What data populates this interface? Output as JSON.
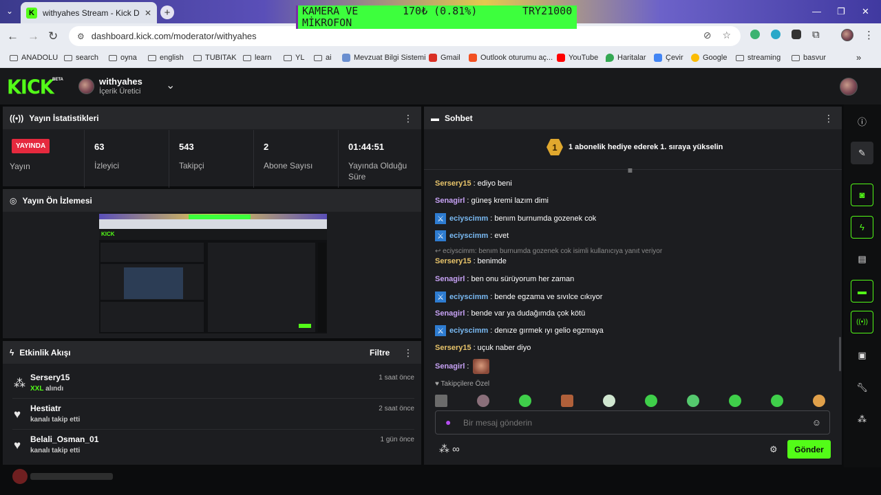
{
  "browser": {
    "tab_title": "withyahes Stream - Kick Dashbo",
    "url": "dashboard.kick.com/moderator/withyahes",
    "overlay": {
      "line1_a": "KAMERA VE",
      "line1_b": "170₺ (0.81%)",
      "line1_c": "TRY21000",
      "line2": "MİKROFON"
    },
    "bookmarks": [
      {
        "label": "ANADOLU",
        "kind": "folder"
      },
      {
        "label": "search",
        "kind": "folder"
      },
      {
        "label": "oyna",
        "kind": "folder"
      },
      {
        "label": "english",
        "kind": "folder"
      },
      {
        "label": "TUBITAK",
        "kind": "folder"
      },
      {
        "label": "learn",
        "kind": "folder"
      },
      {
        "label": "YL",
        "kind": "folder"
      },
      {
        "label": "ai",
        "kind": "folder"
      },
      {
        "label": "Mevzuat Bilgi Sistemi",
        "kind": "site",
        "color": "#6a8fd0"
      },
      {
        "label": "Gmail",
        "kind": "site",
        "color": "#d93025"
      },
      {
        "label": "Outlook oturumu aç...",
        "kind": "site",
        "color": "#f25022"
      },
      {
        "label": "YouTube",
        "kind": "site",
        "color": "#ff0000"
      },
      {
        "label": "Haritalar",
        "kind": "site",
        "color": "#34a853"
      },
      {
        "label": "Çevir",
        "kind": "site",
        "color": "#4285f4"
      },
      {
        "label": "Google",
        "kind": "site",
        "color": "#fbbc05"
      },
      {
        "label": "streaming",
        "kind": "folder"
      },
      {
        "label": "basvur",
        "kind": "folder"
      }
    ]
  },
  "header": {
    "logo": "KICK",
    "beta": "BETA",
    "username": "withyahes",
    "role": "İçerik Üretici"
  },
  "stats": {
    "title": "Yayın İstatistikleri",
    "live_badge": "YAYINDA",
    "live_label": "Yayın",
    "cells": [
      {
        "value": "63",
        "label": "İzleyici"
      },
      {
        "value": "543",
        "label": "Takipçi"
      },
      {
        "value": "2",
        "label": "Abone Sayısı"
      },
      {
        "value": "01:44:51",
        "label": "Yayında Olduğu Süre"
      }
    ]
  },
  "preview": {
    "title": "Yayın Ön İzlemesi"
  },
  "activity": {
    "title": "Etkinlik Akışı",
    "filter_label": "Filtre",
    "items": [
      {
        "name": "Sersery15",
        "highlight": "XXL",
        "desc": "alındı",
        "time": "1 saat önce",
        "icon": "kicks-icon"
      },
      {
        "name": "Hestiatr",
        "highlight": "",
        "desc": "kanalı takip etti",
        "time": "2 saat önce",
        "icon": "heart-icon"
      },
      {
        "name": "Belali_Osman_01",
        "highlight": "",
        "desc": "kanalı takip etti",
        "time": "1 gün önce",
        "icon": "heart-icon"
      }
    ]
  },
  "chat": {
    "title": "Sohbet",
    "gift_banner": "1 abonelik hediye ederek 1. sıraya yükselin",
    "rank": "1",
    "messages": [
      {
        "user": "Sersery15",
        "text": "ediyo beni",
        "color": "#e8c46a",
        "badge": false
      },
      {
        "user": "Senagirl",
        "text": "güneş kremi lazım dimi",
        "color": "#c7a2f5",
        "badge": false
      },
      {
        "user": "eciyscimm",
        "text": "benım burnumda gozenek cok",
        "color": "#79b9f2",
        "badge": true
      },
      {
        "user": "eciyscimm",
        "text": "evet",
        "color": "#79b9f2",
        "badge": true
      },
      {
        "user": "Sersery15",
        "text": "benimde",
        "color": "#e8c46a",
        "badge": false,
        "reply": "eciyscimm: benım burnumda gozenek cok isimli kullanıcıya yanıt veriyor"
      },
      {
        "user": "Senagirl",
        "text": "ben onu sürüyorum her zaman",
        "color": "#c7a2f5",
        "badge": false
      },
      {
        "user": "eciyscimm",
        "text": "bende egzama ve sıvılce cıkıyor",
        "color": "#79b9f2",
        "badge": true
      },
      {
        "user": "Senagirl",
        "text": "bende var ya dudağımda çok kötü",
        "color": "#c7a2f5",
        "badge": false
      },
      {
        "user": "eciyscimm",
        "text": "denıze gırmek ıyı gelio egzmaya",
        "color": "#79b9f2",
        "badge": true
      },
      {
        "user": "Sersery15",
        "text": "uçuk naber diyo",
        "color": "#e8c46a",
        "badge": false
      },
      {
        "user": "Senagirl",
        "text": "",
        "color": "#c7a2f5",
        "badge": false,
        "emote": true
      }
    ],
    "followers_only": "Takipçilere Özel",
    "input_placeholder": "Bir mesaj gönderin",
    "send_label": "Gönder"
  },
  "colors": {
    "accent": "#53fc18",
    "live": "#e5293e",
    "panel": "#1c1d20",
    "panel_header": "#27282b"
  }
}
